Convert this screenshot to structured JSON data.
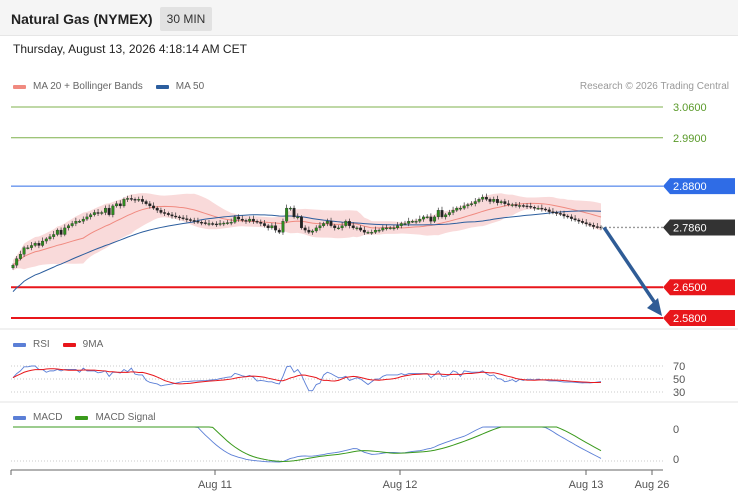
{
  "header": {
    "instrument": "Natural Gas (NYMEX)",
    "timeframe": "30 MIN",
    "timestamp": "Thursday, August 13, 2026 4:18:14 AM CET"
  },
  "legend_main": [
    {
      "label": "MA 20 + Bollinger Bands",
      "color": "#f08a80"
    },
    {
      "label": "MA 50",
      "color": "#2c5e9e"
    }
  ],
  "credit": "Research © 2026 Trading Central",
  "legend_rsi": [
    {
      "label": "RSI",
      "color": "#5b7fd6"
    },
    {
      "label": "9MA",
      "color": "#e8161b"
    }
  ],
  "legend_macd": [
    {
      "label": "MACD",
      "color": "#5b7fd6"
    },
    {
      "label": "MACD Signal",
      "color": "#3a9a1c"
    }
  ],
  "colors": {
    "support": "#e8161b",
    "resistance": "#2f6ce6",
    "target": "#7fb04c",
    "current": "#333333",
    "arrow": "#2f5c96",
    "bollinger": "#f7cdcd"
  },
  "chart_data": {
    "type": "candlestick",
    "price_range": [
      2.535,
      3.085
    ],
    "current_price": "2.7860",
    "x_tick_labels": [
      "Aug 11",
      "Aug 12",
      "Aug 13",
      "Aug 26"
    ],
    "levels": [
      {
        "value": "3.0600",
        "kind": "target"
      },
      {
        "value": "2.9900",
        "kind": "target"
      },
      {
        "value": "2.8800",
        "kind": "resistance"
      },
      {
        "value": "2.6500",
        "kind": "support"
      },
      {
        "value": "2.5800",
        "kind": "support"
      }
    ],
    "forecast_arrow": {
      "from": 2.786,
      "to": 2.58
    },
    "closes": [
      2.7,
      2.715,
      2.725,
      2.74,
      2.74,
      2.745,
      2.75,
      2.745,
      2.755,
      2.76,
      2.765,
      2.77,
      2.78,
      2.77,
      2.785,
      2.79,
      2.795,
      2.8,
      2.8,
      2.805,
      2.81,
      2.815,
      2.82,
      2.818,
      2.82,
      2.83,
      2.815,
      2.835,
      2.84,
      2.835,
      2.85,
      2.852,
      2.85,
      2.848,
      2.85,
      2.845,
      2.84,
      2.835,
      2.83,
      2.825,
      2.82,
      2.818,
      2.815,
      2.812,
      2.81,
      2.808,
      2.806,
      2.804,
      2.802,
      2.8,
      2.798,
      2.797,
      2.795,
      2.795,
      2.794,
      2.793,
      2.795,
      2.796,
      2.797,
      2.798,
      2.81,
      2.805,
      2.802,
      2.8,
      2.805,
      2.8,
      2.798,
      2.795,
      2.79,
      2.785,
      2.79,
      2.78,
      2.775,
      2.8,
      2.83,
      2.83,
      2.81,
      2.81,
      2.785,
      2.78,
      2.775,
      2.778,
      2.785,
      2.79,
      2.795,
      2.8,
      2.79,
      2.785,
      2.785,
      2.79,
      2.8,
      2.79,
      2.785,
      2.785,
      2.78,
      2.775,
      2.775,
      2.775,
      2.78,
      2.78,
      2.785,
      2.785,
      2.785,
      2.785,
      2.79,
      2.795,
      2.795,
      2.8,
      2.8,
      2.8,
      2.805,
      2.81,
      2.81,
      2.8,
      2.81,
      2.825,
      2.81,
      2.815,
      2.82,
      2.825,
      2.83,
      2.83,
      2.835,
      2.838,
      2.84,
      2.845,
      2.85,
      2.855,
      2.85,
      2.845,
      2.85,
      2.842,
      2.845,
      2.84,
      2.838,
      2.838,
      2.835,
      2.836,
      2.835,
      2.834,
      2.832,
      2.83,
      2.83,
      2.828,
      2.826,
      2.822,
      2.82,
      2.818,
      2.816,
      2.812,
      2.81,
      2.806,
      2.803,
      2.8,
      2.797,
      2.794,
      2.791,
      2.788,
      2.787,
      2.786
    ],
    "rsi": {
      "ticks": [
        "70",
        "50",
        "30"
      ],
      "range": [
        20,
        90
      ]
    },
    "macd": {
      "ticks": [
        "0",
        "0"
      ]
    }
  }
}
